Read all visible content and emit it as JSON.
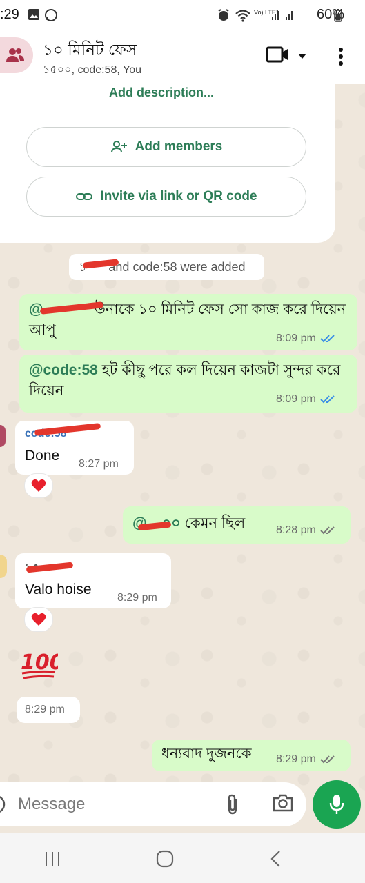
{
  "status_bar": {
    "time": ":29",
    "battery": "60%",
    "network_label": "Vo) LTE1"
  },
  "header": {
    "title": "১০ মিনিট ফেস",
    "subtitle": "১৫০০, code:58, You"
  },
  "group_info": {
    "add_description": "Add description...",
    "add_members": "Add members",
    "invite_link": "Invite via link or QR code"
  },
  "system_notice": {
    "text": "and code:58 were added",
    "prefix_visible": "১"
  },
  "messages": [
    {
      "direction": "out",
      "mention": "@",
      "text": "উনাকে ১০ মিনিট ফেস সো কাজ করে দিয়েন আপু",
      "time": "8:09 pm",
      "status": "read"
    },
    {
      "direction": "out",
      "mention": "@code:58",
      "text": "হট কীছু পরে কল দিয়েন কাজটা সুন্দর করে দিয়েন",
      "time": "8:09 pm",
      "status": "read"
    },
    {
      "direction": "in",
      "sender": "code:58",
      "text": "Done",
      "time": "8:27 pm",
      "reaction": "heart"
    },
    {
      "direction": "out",
      "mention": "@",
      "mention_tail": "০০",
      "text": "কেমন ছিল",
      "time": "8:28 pm",
      "status": "delivered"
    },
    {
      "direction": "in",
      "sender": "১৫",
      "text": "Valo hoise",
      "time": "8:29 pm",
      "reaction": "heart"
    },
    {
      "direction": "in",
      "sticker": "100",
      "time": "8:29 pm"
    },
    {
      "direction": "out",
      "text": "ধন্যবাদ দুজনকে",
      "time": "8:29 pm",
      "status": "delivered"
    }
  ],
  "input": {
    "placeholder": "Message"
  },
  "colors": {
    "accent_green": "#2d7d57",
    "outgoing_bubble": "#d8fbc9",
    "read_tick": "#3a8ee6",
    "mic_button": "#1aa552",
    "redaction": "#e3362c"
  },
  "icons": [
    "group-avatar-icon",
    "video-call-icon",
    "more-menu-icon",
    "add-person-icon",
    "link-icon",
    "heart-reaction-icon",
    "attach-icon",
    "camera-icon",
    "mic-icon"
  ]
}
